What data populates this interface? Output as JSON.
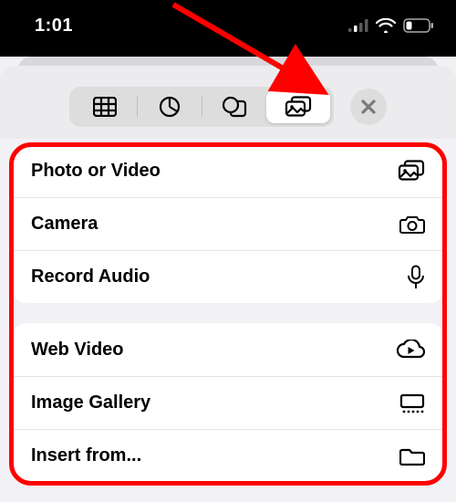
{
  "status": {
    "time": "1:01"
  },
  "toolbar": {
    "tabs": [
      "table",
      "chart",
      "shapes",
      "media"
    ],
    "selected": "media"
  },
  "groups": [
    {
      "items": [
        {
          "label": "Photo or Video",
          "icon": "media-icon",
          "name": "row-photo-or-video"
        },
        {
          "label": "Camera",
          "icon": "camera-icon",
          "name": "row-camera"
        },
        {
          "label": "Record Audio",
          "icon": "microphone-icon",
          "name": "row-record-audio"
        }
      ]
    },
    {
      "items": [
        {
          "label": "Web Video",
          "icon": "cloud-play-icon",
          "name": "row-web-video"
        },
        {
          "label": "Image Gallery",
          "icon": "gallery-icon",
          "name": "row-image-gallery"
        },
        {
          "label": "Insert from...",
          "icon": "folder-icon",
          "name": "row-insert-from"
        }
      ]
    }
  ]
}
